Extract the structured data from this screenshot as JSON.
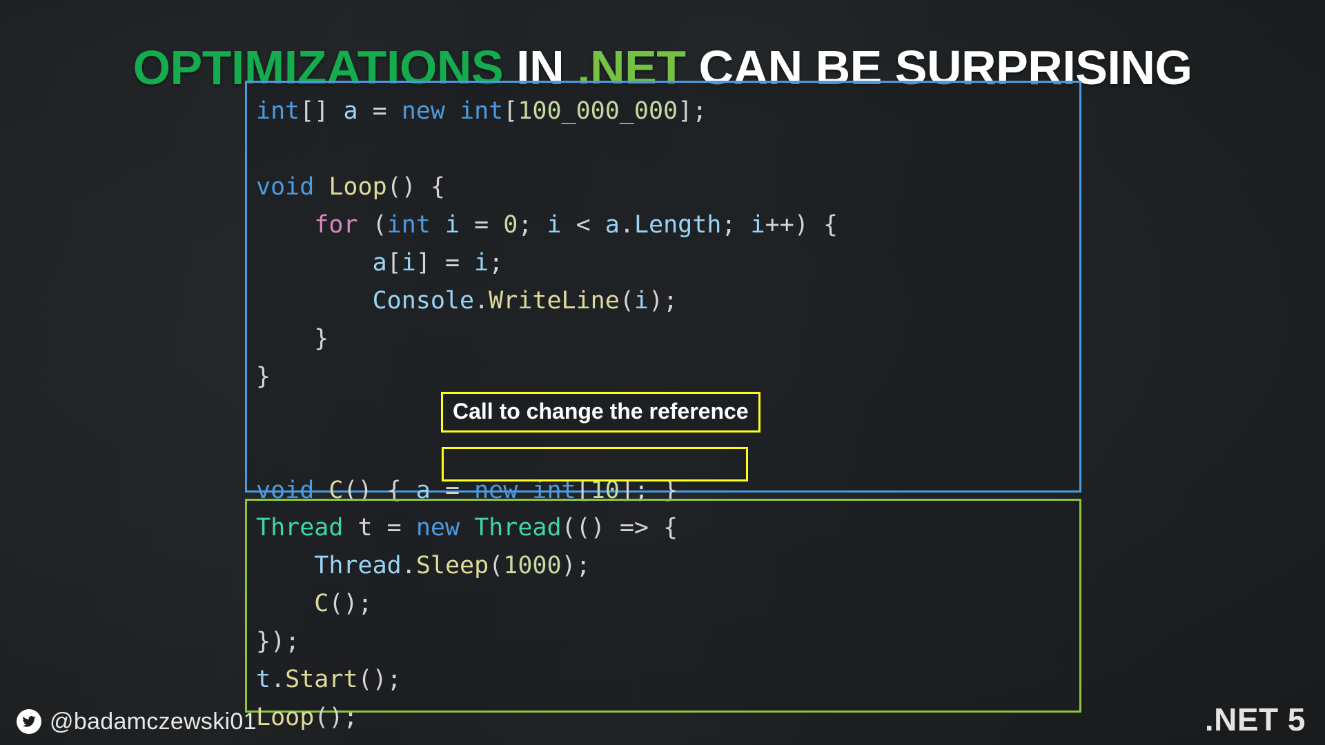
{
  "slide": {
    "background_color": "#1e2123",
    "title": {
      "segments": [
        {
          "text": "OPTIMIZATIONS",
          "color": "#15ab4f"
        },
        {
          "text": " IN ",
          "color": "#ffffff"
        },
        {
          "text": ".NET",
          "color": "#76c043"
        },
        {
          "text": " CAN BE SURPRISING",
          "color": "#ffffff"
        }
      ],
      "full_text": "OPTIMIZATIONS IN .NET CAN BE SURPRISING"
    }
  },
  "code_main": {
    "border_color": "#4d9ade",
    "line1": {
      "t1": "int",
      "t2": "[] ",
      "t3": "a",
      "t4": " = ",
      "t5": "new ",
      "t6": "int",
      "t7": "[",
      "t8": "100_000_000",
      "t9": "];"
    },
    "line2": "",
    "line3": {
      "t1": "void ",
      "t2": "Loop",
      "t3": "() {"
    },
    "line4": {
      "t1": "    ",
      "t2": "for",
      "t3": " (",
      "t4": "int",
      "t5": " ",
      "t6": "i",
      "t7": " = ",
      "t8": "0",
      "t9": "; ",
      "t10": "i",
      "t11": " < ",
      "t12": "a",
      "t13": ".",
      "t14": "Length",
      "t15": "; ",
      "t16": "i",
      "t17": "++) {"
    },
    "line5": {
      "t1": "        ",
      "t2": "a",
      "t3": "[",
      "t4": "i",
      "t5": "] = ",
      "t6": "i",
      "t7": ";"
    },
    "line6": {
      "t1": "        ",
      "t2": "Console",
      "t3": ".",
      "t4": "WriteLine",
      "t5": "(",
      "t6": "i",
      "t7": ");"
    },
    "line7": "    }",
    "line8": "}",
    "line9": "",
    "line10": "",
    "line11": {
      "t1": "void ",
      "t2": "C",
      "t3": "() { ",
      "t4": "a",
      "t5": " = ",
      "t6": "new ",
      "t7": "int",
      "t8": "[",
      "t9": "10",
      "t10": "]; ",
      "t11": "}"
    }
  },
  "code_thread": {
    "border_color": "#8cc63f",
    "line1": {
      "t1": "Thread",
      "t2": " ",
      "t3": "t",
      "t4": " = ",
      "t5": "new ",
      "t6": "Thread",
      "t7": "(() => {"
    },
    "line2": {
      "t1": "    ",
      "t2": "Thread",
      "t3": ".",
      "t4": "Sleep",
      "t5": "(",
      "t6": "1000",
      "t7": ");"
    },
    "line3": {
      "t1": "    ",
      "t2": "C",
      "t3": "();"
    },
    "line4": "});",
    "line5": {
      "t1": "t",
      "t2": ".",
      "t3": "Start",
      "t4": "();"
    },
    "line6": {
      "t1": "Loop",
      "t2": "();"
    }
  },
  "annotations": {
    "callout_label": "Call to change the reference",
    "callout_border_color": "#ffff1e",
    "highlight_target": "a = new int[10];"
  },
  "footer": {
    "twitter_icon": "twitter-bird-icon",
    "handle": "@badamczewski01",
    "dotnet_version": ".NET 5"
  }
}
